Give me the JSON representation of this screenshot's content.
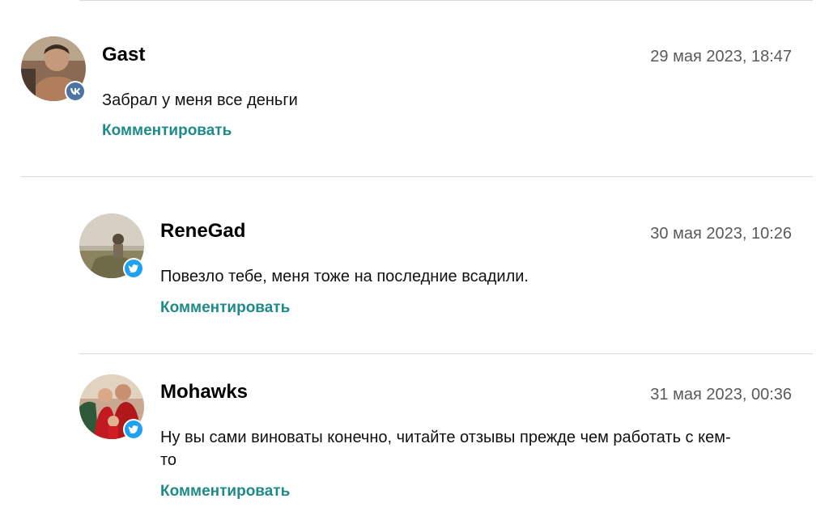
{
  "comments": [
    {
      "author": "Gast",
      "date": "29 мая 2023, 18:47",
      "text": "Забрал у меня все деньги",
      "reply_label": "Комментировать",
      "social": "vk-icon"
    },
    {
      "author": "ReneGad",
      "date": "30 мая 2023, 10:26",
      "text": "Повезло тебе, меня тоже на последние всадили.",
      "reply_label": "Комментировать",
      "social": "twitter-icon"
    },
    {
      "author": "Mohawks",
      "date": "31 мая 2023, 00:36",
      "text": "Ну вы сами виноваты конечно, читайте отзывы прежде чем работать с кем-то",
      "reply_label": "Комментировать",
      "social": "twitter-icon"
    }
  ],
  "colors": {
    "link": "#1e8a8a",
    "divider": "#d9d9d9",
    "vk": "#4c75a3",
    "twitter": "#1da1f2"
  }
}
